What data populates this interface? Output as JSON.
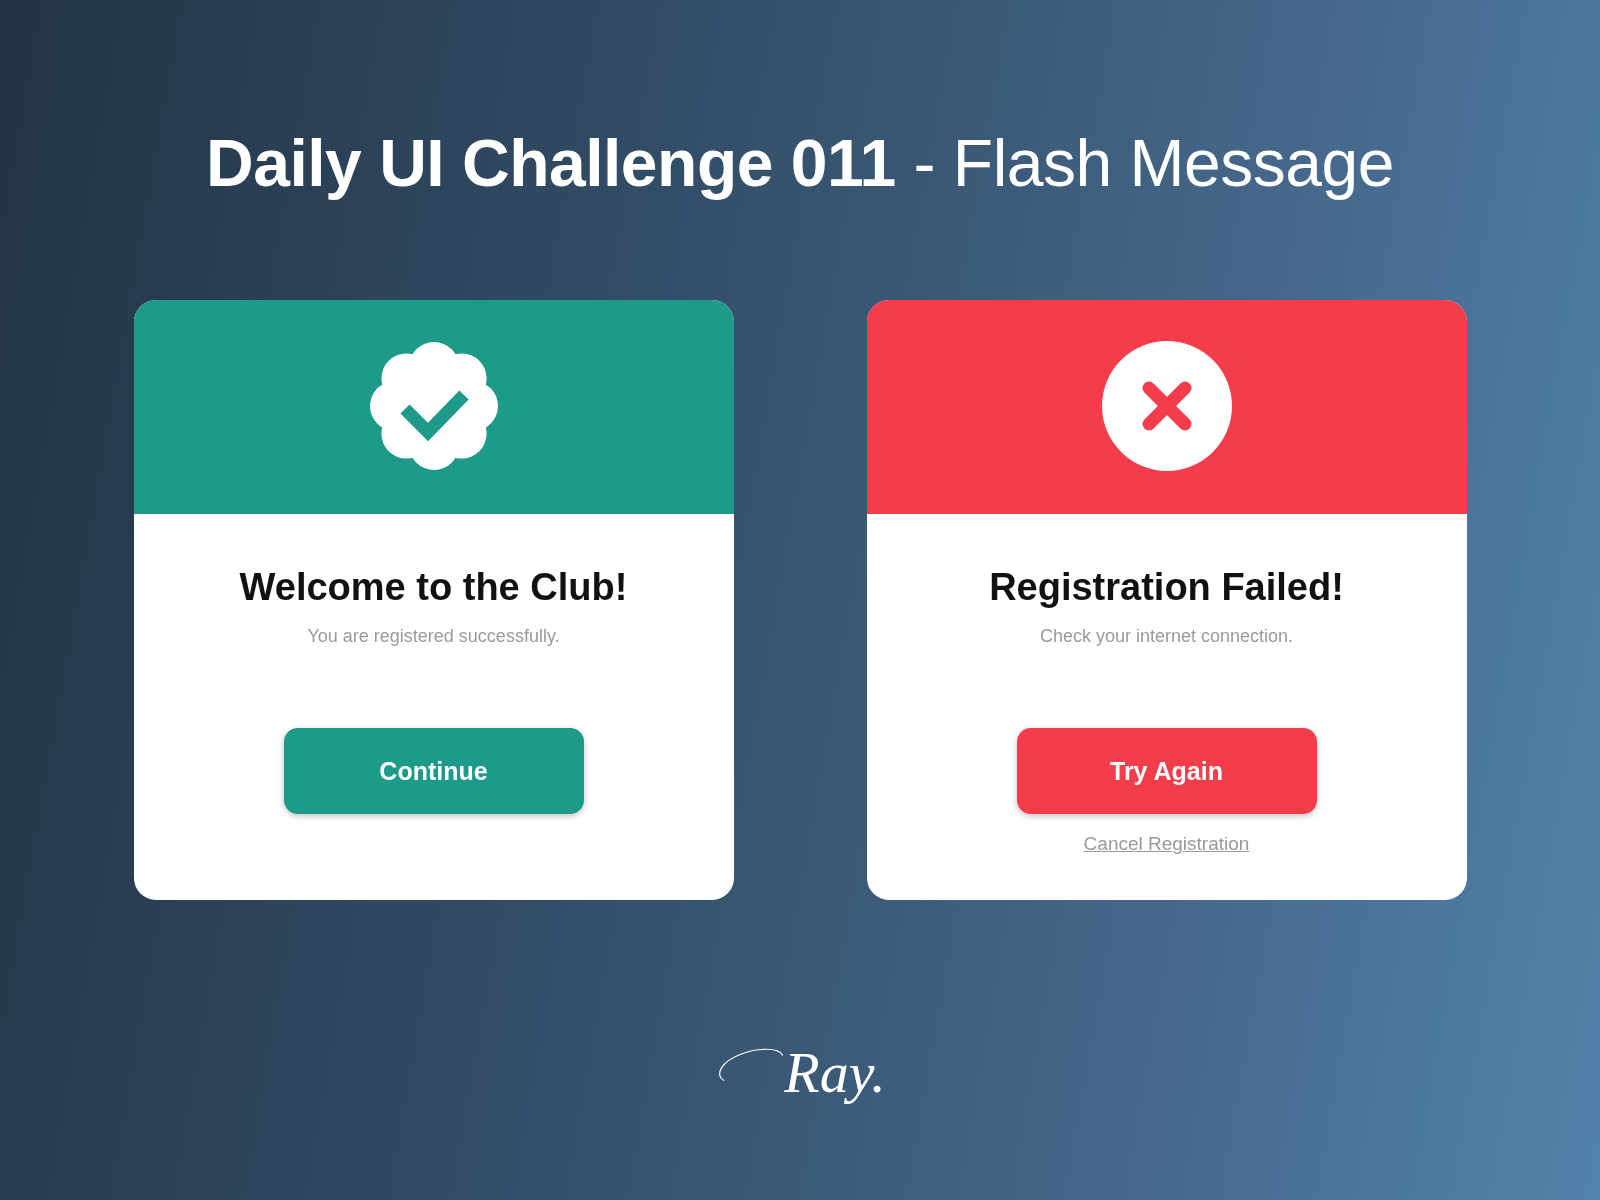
{
  "page": {
    "title": "**Daily UI Challenge 011** - Flash Message"
  },
  "cards": [
    {
      "kind": "success",
      "color": "#1d9a8a",
      "heading": "Welcome to the Club!",
      "message": "You are registered successfully.",
      "button": "Continue"
    },
    {
      "kind": "error",
      "color": "#f53c4b",
      "heading": "Registration Failed!",
      "message": "Check your internet connection.",
      "button": "Try Again",
      "link": "Cancel Registration"
    }
  ],
  "signature": "Ray."
}
